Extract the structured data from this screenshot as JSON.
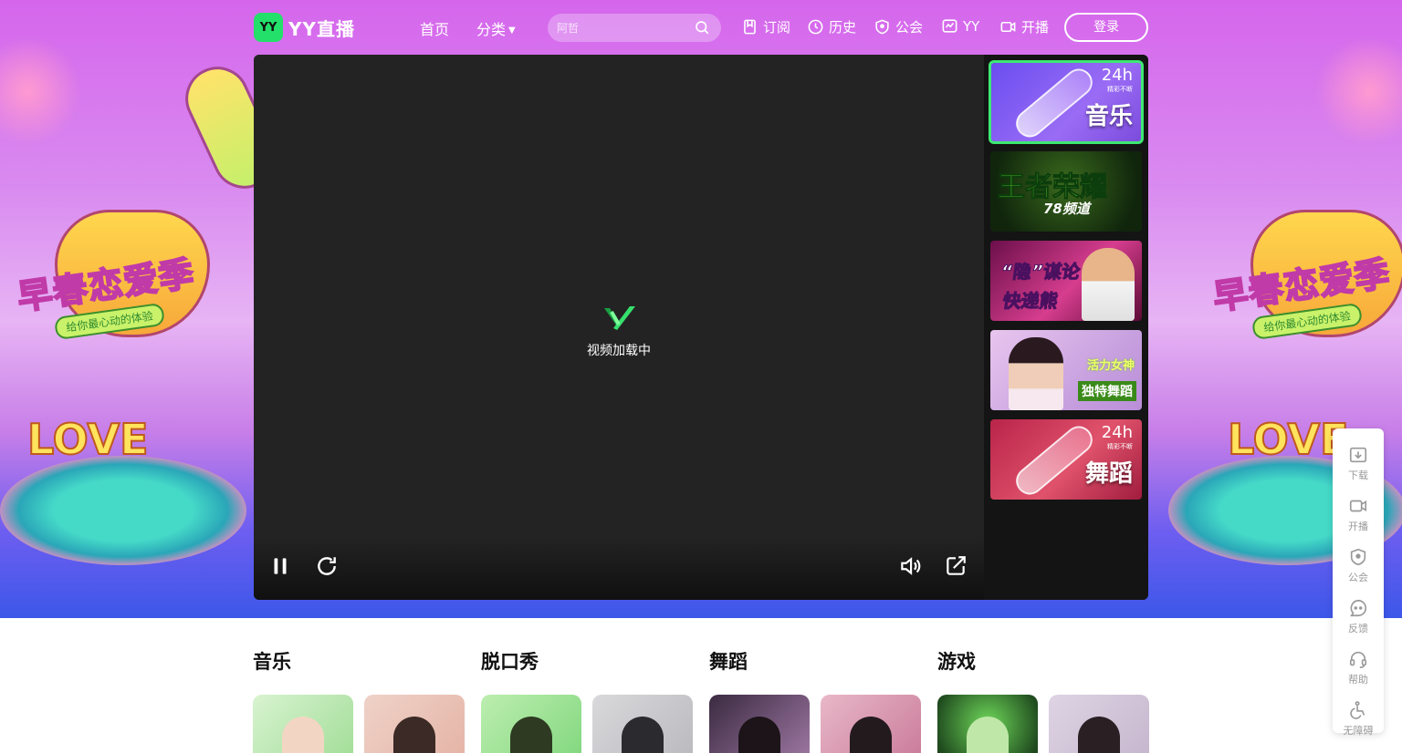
{
  "nav": {
    "logo_text": "YY直播",
    "logo_mark": "YY",
    "home": "首页",
    "category": "分类",
    "search_placeholder": "阿哲",
    "items": [
      {
        "label": "订阅",
        "icon": "bookmark-icon"
      },
      {
        "label": "历史",
        "icon": "clock-icon"
      },
      {
        "label": "公会",
        "icon": "shield-icon"
      },
      {
        "label": "YY",
        "icon": "yy-chart-icon"
      },
      {
        "label": "开播",
        "icon": "camera-icon"
      }
    ],
    "login": "登录"
  },
  "hero": {
    "poster_title": "早春恋爱季",
    "poster_subtitle": "给你最心动的体验",
    "love": "LOVE",
    "accent": "#3de872"
  },
  "player": {
    "loading_text": "视频加载中",
    "controls": {
      "pause": "pause-icon",
      "refresh": "refresh-icon",
      "volume": "volume-icon",
      "popout": "popout-icon"
    },
    "side_thumbs": [
      {
        "title": "音乐",
        "badge": "24h",
        "badge_sub": "精彩不断",
        "active": true
      },
      {
        "title": "王者荣耀",
        "sub": "78频道"
      },
      {
        "line1": "“隐”谋论",
        "line2": "快递熊"
      },
      {
        "line1": "活力女神",
        "line2": "独特舞蹈"
      },
      {
        "title": "舞蹈",
        "badge": "24h",
        "badge_sub": "精彩不断"
      }
    ]
  },
  "tools": [
    {
      "label": "下载",
      "icon": "download-icon"
    },
    {
      "label": "开播",
      "icon": "camera-icon"
    },
    {
      "label": "公会",
      "icon": "shield-icon"
    },
    {
      "label": "反馈",
      "icon": "feedback-icon"
    },
    {
      "label": "帮助",
      "icon": "headset-icon"
    },
    {
      "label": "无障碍",
      "icon": "accessibility-icon"
    }
  ],
  "categories": [
    {
      "title": "音乐"
    },
    {
      "title": "脱口秀"
    },
    {
      "title": "舞蹈"
    },
    {
      "title": "游戏"
    }
  ]
}
